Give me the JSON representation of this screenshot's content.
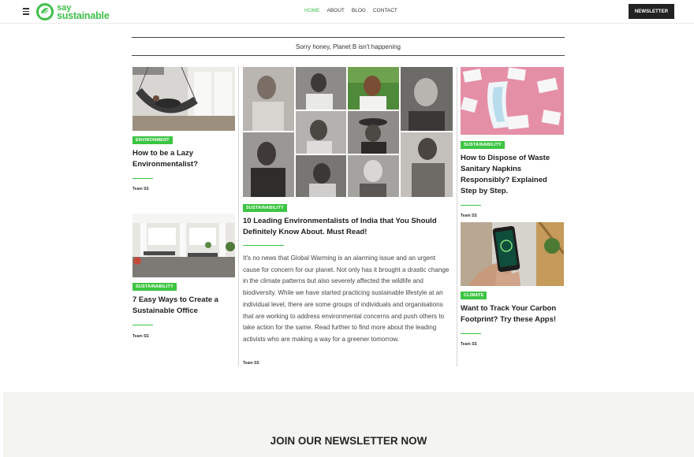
{
  "header": {
    "logo_line1": "say",
    "logo_line2": "sustainable",
    "nav": [
      "HOME",
      "ABOUT",
      "BLOG",
      "CONTACT"
    ],
    "newsletter_button": "NEWSLETTER"
  },
  "tagline": "Sorry honey, Planet B isn't happening",
  "articles": {
    "left1": {
      "category": "ENVIRONMENT",
      "title_lines": [
        "How to be a Lazy",
        "Environmentalist?"
      ],
      "author": "Team SS"
    },
    "left2": {
      "category": "SUSTAINABILITY",
      "title_lines": [
        "7 Easy Ways to Create a",
        "Sustainable Office"
      ],
      "author": "Team SS"
    },
    "center": {
      "category": "SUSTAINABILITY",
      "title_lines": [
        "10 Leading Environmentalists of India that You Should",
        "Definitely Know About. Must Read!"
      ],
      "excerpt": "It's no news that Global Warming is an alarming issue and an urgent cause for concern for our planet. Not only has it brought a drastic change in the climate patterns but also severely affected the wildlife and biodiversity. While we have started practicing sustainable lifestyle at an individual level, there are some groups of individuals and organisations that are working to address environmental concerns and push others to take action for the same. Read further to find more about the leading activists who are making a way for a greener tomorrow.",
      "author": "Team SS"
    },
    "right1": {
      "category": "SUSTAINABILITY",
      "title_lines": [
        "How to Dispose of Waste",
        "Sanitary Napkins",
        "Responsibly? Explained",
        "Step by Step."
      ],
      "author": "Team SS"
    },
    "right2": {
      "category": "CLIMATE",
      "title_lines": [
        "Want to Track Your Carbon",
        "Footprint? Try these Apps!"
      ],
      "author": "Team SS"
    }
  },
  "newsletter_section": {
    "title": "JOIN OUR NEWSLETTER NOW"
  },
  "colors": {
    "accent": "#3cc542",
    "dark": "#222222"
  }
}
